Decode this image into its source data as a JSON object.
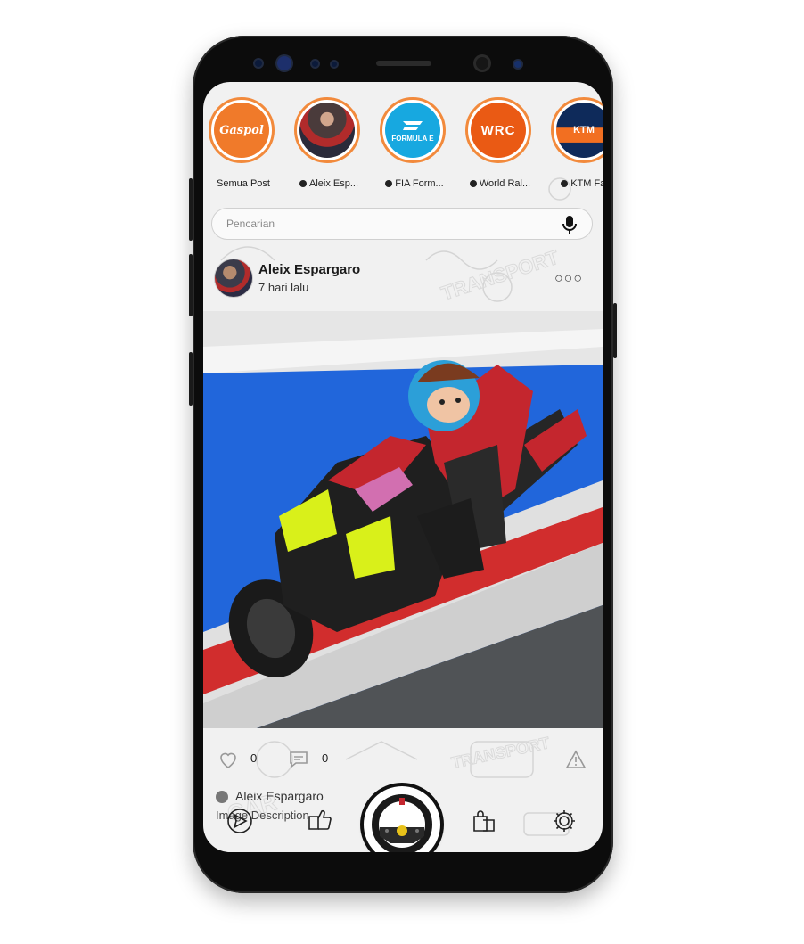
{
  "stories": [
    {
      "label": "Semua Post",
      "verified": false,
      "logo_text": "Gaspol",
      "color": "#f07a2a"
    },
    {
      "label": "Aleix Esp...",
      "verified": true,
      "logo_text": "",
      "color": "#4a3b3b"
    },
    {
      "label": "FIA Form...",
      "verified": true,
      "logo_text": "FORMULA E",
      "color": "#17a8e0"
    },
    {
      "label": "World Ral...",
      "verified": true,
      "logo_text": "WRC",
      "color": "#ea5a14"
    },
    {
      "label": "KTM Fac",
      "verified": true,
      "logo_text": "KTM",
      "color": "#0e2a5a"
    }
  ],
  "search": {
    "placeholder": "Pencarian"
  },
  "post": {
    "author": "Aleix Espargaro",
    "time": "7 hari lalu",
    "likes": "0",
    "comments": "0",
    "caption_author": "Aleix Espargaro",
    "caption_text": "Image Description"
  },
  "tabs": [
    "send-icon",
    "thumbs-up-chat-icon",
    "steering-wheel-icon",
    "shopping-bags-icon",
    "settings-gear-icon"
  ],
  "colors": {
    "accent": "#f28a3c",
    "phone": "#0c0c0c"
  }
}
